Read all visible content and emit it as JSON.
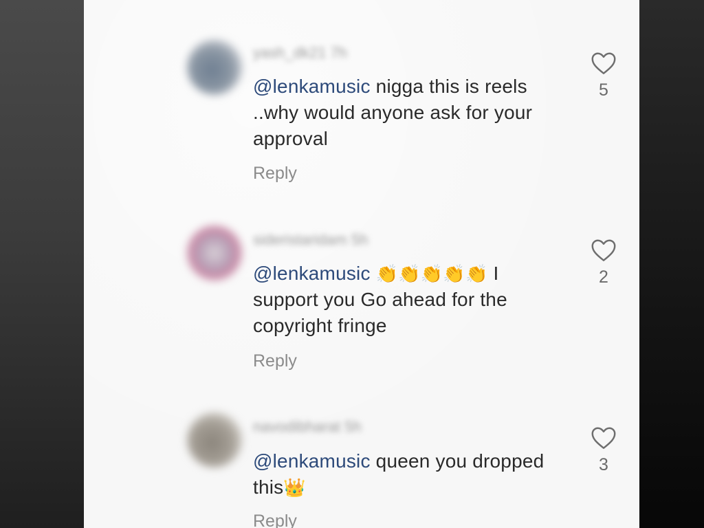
{
  "comments": [
    {
      "username": "yash_dk21 7h",
      "mention": "@lenkamusic",
      "text": " nigga this is reels ..why would anyone ask for your approval",
      "reply_label": "Reply",
      "likes": "5"
    },
    {
      "username": "sideristaridam 5h",
      "mention": "@lenkamusic",
      "emojis": "👏👏👏👏👏",
      "text": " I support you Go ahead for the copyright fringe",
      "reply_label": "Reply",
      "likes": "2"
    },
    {
      "username": "navodibharat 5h",
      "mention": "@lenkamusic",
      "text": " queen you dropped this",
      "emojis": "👑",
      "reply_label": "Reply",
      "likes": "3"
    }
  ],
  "colors": {
    "mention": "#2d4a7a",
    "text": "#2a2a2a",
    "secondary": "#8b8b8b",
    "background": "#f7f7f7"
  },
  "icons": {
    "like": "heart-outline-icon"
  }
}
